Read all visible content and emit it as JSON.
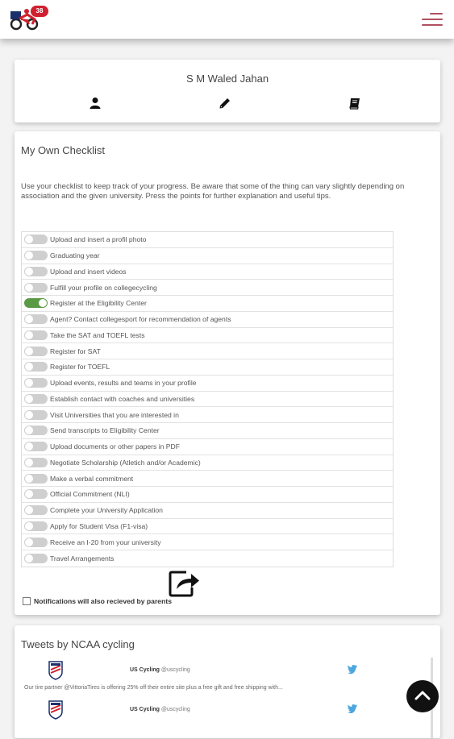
{
  "header": {
    "badge_count": "38",
    "accent_color": "#d0202f",
    "menu_icon": "hamburger-icon"
  },
  "profile": {
    "name": "S M Waled Jahan",
    "icons": [
      "user-icon",
      "pencil-icon",
      "book-icon"
    ]
  },
  "checklist": {
    "title": "My Own Checklist",
    "intro": "Use your checklist to keep track of your progress. Be aware that some of the thing can vary slightly depending on association and the given university. Press the points for further explanation and useful tips.",
    "items": [
      {
        "label": "Upload and insert a profil photo",
        "checked": false
      },
      {
        "label": "Graduating year",
        "checked": false
      },
      {
        "label": "Upload and insert videos",
        "checked": false
      },
      {
        "label": "Fulfill your profile on collegecycling",
        "checked": false
      },
      {
        "label": "Register at the Eligibility Center",
        "checked": true
      },
      {
        "label": "Agent? Contact collegesport for recommendation of agents",
        "checked": false
      },
      {
        "label": "Take the SAT and TOEFL tests",
        "checked": false
      },
      {
        "label": "Register for SAT",
        "checked": false
      },
      {
        "label": "Register for TOEFL",
        "checked": false
      },
      {
        "label": "Upload events, results and teams in your profile",
        "checked": false
      },
      {
        "label": "Establish contact with coaches and universities",
        "checked": false
      },
      {
        "label": "Visit Universities that you are interested in",
        "checked": false
      },
      {
        "label": "Send transcripts to Eligibility Center",
        "checked": false
      },
      {
        "label": "Upload documents or other papers in PDF",
        "checked": false
      },
      {
        "label": "Negotiate Scholarship (Atletich and/or Academic)",
        "checked": false
      },
      {
        "label": "Make a verbal commitment",
        "checked": false
      },
      {
        "label": "Official Commitment (NLI)",
        "checked": false
      },
      {
        "label": "Complete your University Application",
        "checked": false
      },
      {
        "label": "Apply for Student Visa (F1-visa)",
        "checked": false
      },
      {
        "label": "Receive an I-20 from your university",
        "checked": false
      },
      {
        "label": "Travel Arrangements",
        "checked": false
      }
    ],
    "toggle_on_color": "#5a9a45",
    "notify_label": "Notifications will also recieved by parents"
  },
  "tweets": {
    "title": "Tweets by NCAA cycling",
    "items": [
      {
        "author": "US Cycling",
        "handle": "@uscycling",
        "text": "Our tire partner @VittoriaTires is offering 25% off their entire site plus a free gift and free shipping with..."
      },
      {
        "author": "US Cycling",
        "handle": "@uscycling",
        "text": ""
      }
    ]
  }
}
